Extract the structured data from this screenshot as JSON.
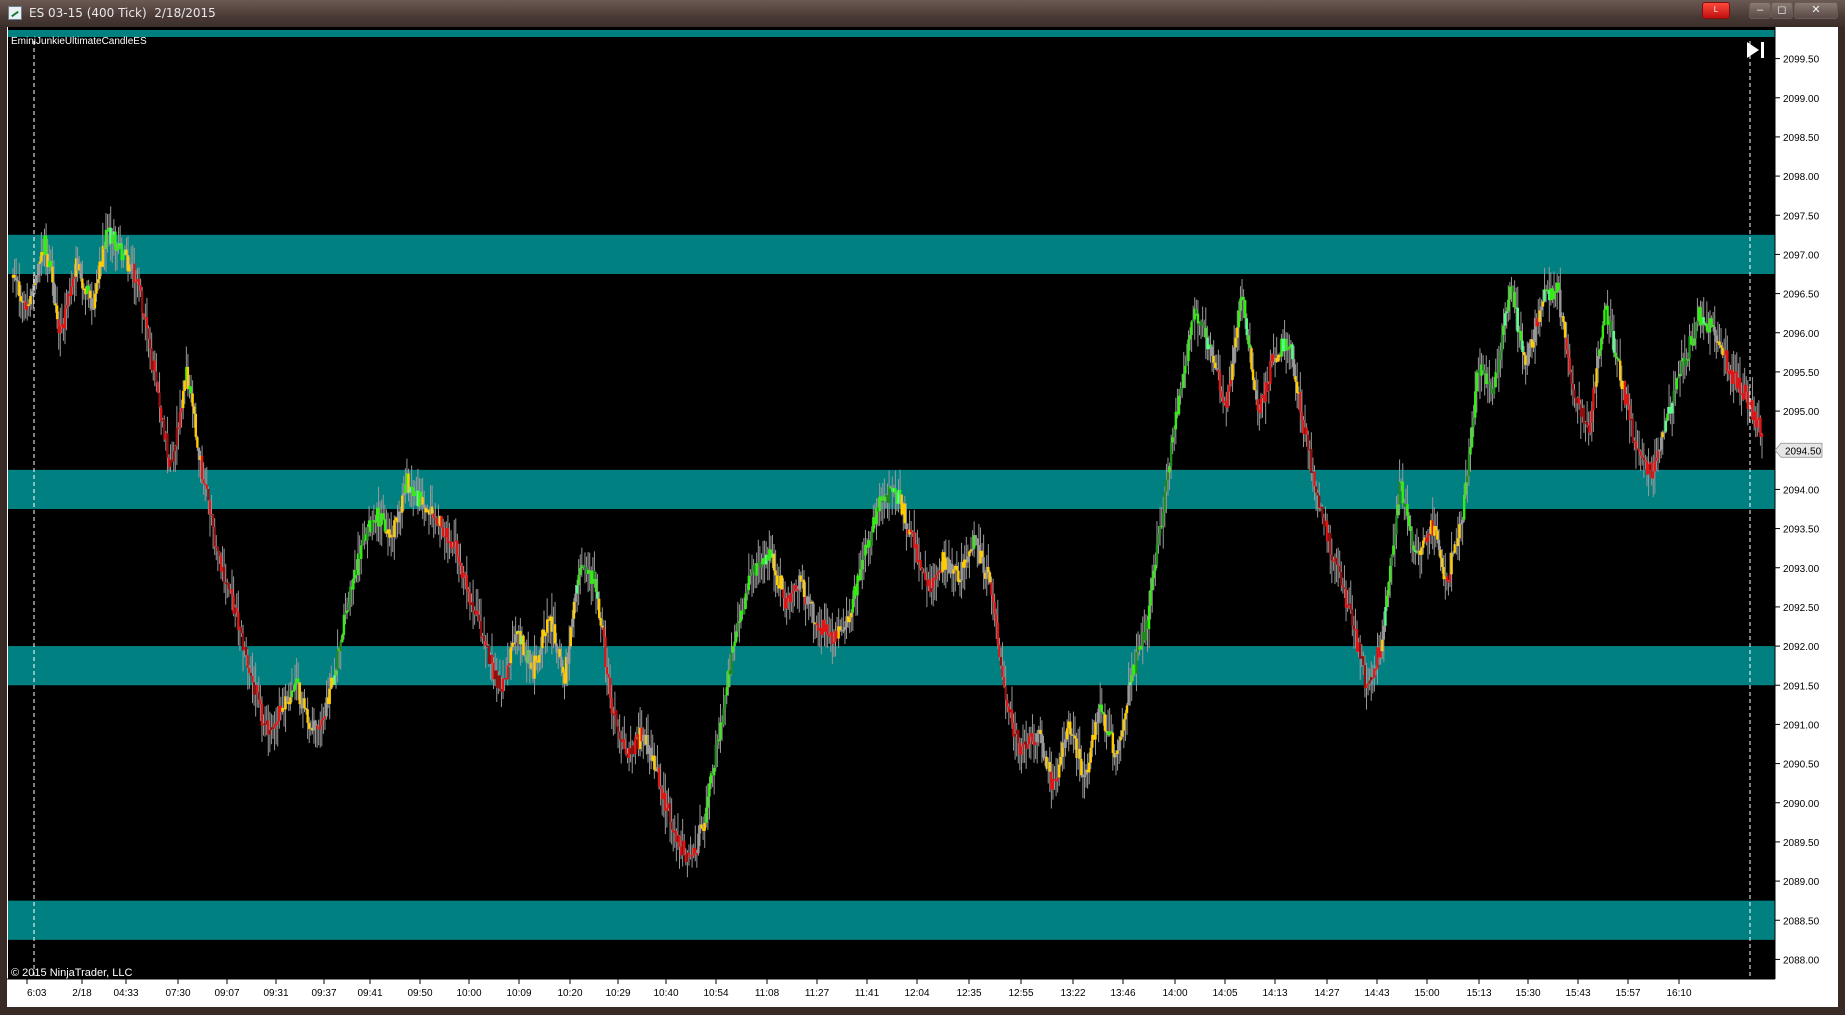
{
  "window": {
    "title": "ES 03-15 (400 Tick)  2/18/2015",
    "buttons": {
      "alert": "L",
      "minimize": "–",
      "restore": "◻",
      "close": "✕"
    }
  },
  "indicator_label": "EminiJunkieUltimateCandleES",
  "copyright": "© 2015 NinjaTrader, LLC",
  "current_price": "2094.50",
  "colors": {
    "background": "#000000",
    "zone": "#008080",
    "bull_strong": "#33ee11",
    "bull_light": "#55ff88",
    "bull_dark": "#1f8a1f",
    "neutral": "#ffcc00",
    "bear": "#e01515",
    "bear_dark": "#901010",
    "wick": "#999999"
  },
  "icons": {
    "scroll_end": "skip-to-end-icon"
  },
  "chart_data": {
    "type": "candlestick",
    "ylim": [
      2087.75,
      2099.75
    ],
    "y_ticks": [
      "2099.50",
      "2099.00",
      "2098.50",
      "2098.00",
      "2097.50",
      "2097.00",
      "2096.50",
      "2096.00",
      "2095.50",
      "2095.00",
      "2094.50",
      "2094.00",
      "2093.50",
      "2093.00",
      "2092.50",
      "2092.00",
      "2091.50",
      "2091.00",
      "2090.50",
      "2090.00",
      "2089.50",
      "2089.00",
      "2088.50",
      "2088.00"
    ],
    "x_ticks": [
      "6:03",
      "2/18",
      "04:33",
      "07:30",
      "09:07",
      "09:31",
      "09:37",
      "09:41",
      "09:50",
      "10:00",
      "10:09",
      "10:20",
      "10:29",
      "10:40",
      "10:54",
      "11:08",
      "11:27",
      "11:41",
      "12:04",
      "12:35",
      "12:55",
      "13:22",
      "13:46",
      "14:00",
      "14:05",
      "14:13",
      "14:27",
      "14:43",
      "15:00",
      "15:13",
      "15:30",
      "15:43",
      "15:57",
      "16:10"
    ],
    "zones": [
      [
        2096.75,
        2097.25
      ],
      [
        2093.75,
        2094.25
      ],
      [
        2091.5,
        2092.0
      ],
      [
        2088.25,
        2088.75
      ]
    ],
    "price_path": [
      2096.7,
      2096.3,
      2097.2,
      2096.0,
      2096.9,
      2096.3,
      2097.3,
      2097.0,
      2096.6,
      2095.4,
      2094.3,
      2095.5,
      2094.2,
      2093.2,
      2092.5,
      2091.7,
      2090.9,
      2091.2,
      2091.5,
      2090.9,
      2091.3,
      2092.3,
      2093.2,
      2093.7,
      2093.4,
      2094.1,
      2093.8,
      2093.6,
      2093.3,
      2092.6,
      2092.0,
      2091.4,
      2092.2,
      2091.7,
      2092.4,
      2091.6,
      2093.0,
      2092.8,
      2091.2,
      2090.6,
      2090.9,
      2090.3,
      2089.6,
      2089.2,
      2089.9,
      2091.1,
      2092.3,
      2093.0,
      2093.2,
      2092.6,
      2092.8,
      2092.3,
      2092.1,
      2092.4,
      2093.1,
      2093.8,
      2094.0,
      2093.4,
      2092.7,
      2093.1,
      2092.9,
      2093.3,
      2092.8,
      2091.3,
      2090.6,
      2090.9,
      2090.2,
      2091.0,
      2090.3,
      2091.2,
      2090.6,
      2091.6,
      2092.3,
      2093.8,
      2095.2,
      2096.3,
      2095.7,
      2095.1,
      2096.5,
      2094.9,
      2095.7,
      2095.9,
      2094.7,
      2093.7,
      2093.0,
      2092.3,
      2091.4,
      2092.2,
      2094.1,
      2093.1,
      2093.6,
      2092.8,
      2093.7,
      2095.6,
      2095.3,
      2096.6,
      2095.6,
      2096.4,
      2096.6,
      2095.2,
      2094.8,
      2096.3,
      2095.5,
      2094.5,
      2094.2,
      2094.9,
      2095.6,
      2096.2,
      2096.0,
      2095.5,
      2095.2,
      2094.7
    ]
  }
}
